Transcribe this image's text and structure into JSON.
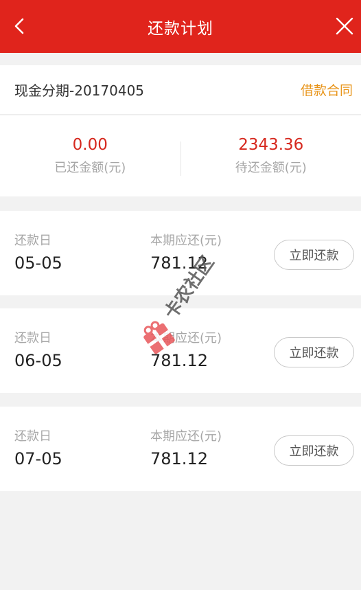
{
  "header": {
    "title": "还款计划"
  },
  "loan": {
    "name": "现金分期-20170405",
    "contract_link": "借款合同"
  },
  "amounts": {
    "repaid": {
      "value": "0.00",
      "label": "已还金额(元)"
    },
    "pending": {
      "value": "2343.36",
      "label": "待还金额(元)"
    }
  },
  "plans": [
    {
      "date_label": "还款日",
      "date": "05-05",
      "amount_label": "本期应还(元)",
      "amount": "781.12",
      "button": "立即还款"
    },
    {
      "date_label": "还款日",
      "date": "06-05",
      "amount_label": "本期应还(元)",
      "amount": "781.12",
      "button": "立即还款"
    },
    {
      "date_label": "还款日",
      "date": "07-05",
      "amount_label": "本期应还(元)",
      "amount": "781.12",
      "button": "立即还款"
    }
  ],
  "watermark": {
    "text": "卡农社区"
  },
  "colors": {
    "header": "#e0241c",
    "accent_red": "#d6281e",
    "link_orange": "#e8951b"
  }
}
